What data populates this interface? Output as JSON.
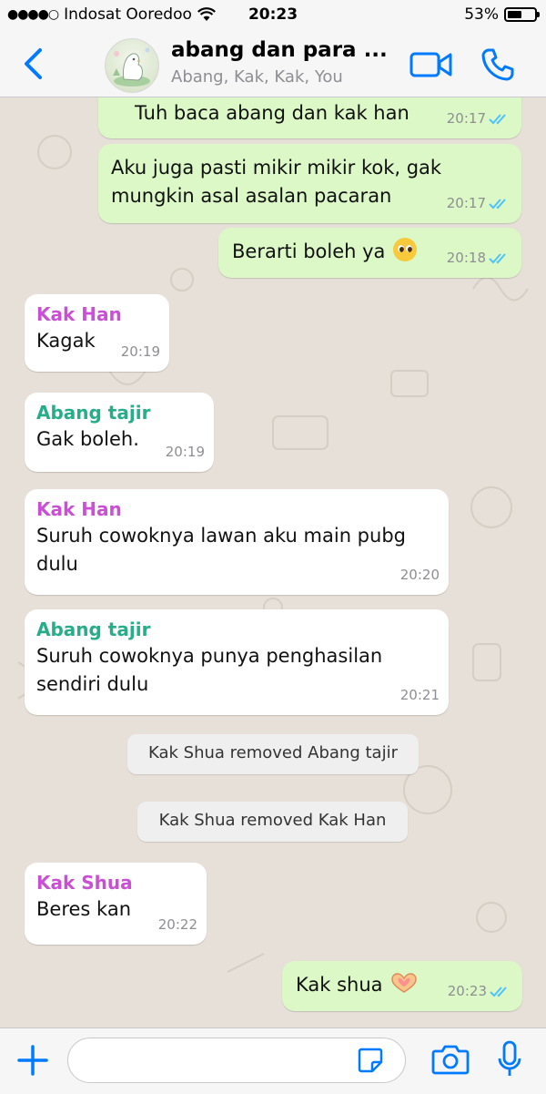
{
  "status_bar": {
    "signal": "●●●●○",
    "carrier": "Indosat Ooredoo",
    "time": "20:23",
    "battery": "53%",
    "battery_level": 0.53
  },
  "header": {
    "title": "abang dan para ...",
    "subtitle": "Abang, Kak, Kak, You"
  },
  "colors": {
    "accent": "#007aff",
    "outgoing_bubble": "#dcf8c6",
    "incoming_bubble": "#ffffff",
    "read_ticks": "#4fc3f7",
    "sender_kak_han": "#c94fd4",
    "sender_abang_tajir": "#27ad8a",
    "sender_kak_shua": "#c94fd4"
  },
  "messages": [
    {
      "text": "Tuh baca abang dan kak han",
      "time": "20:17"
    },
    {
      "text": "Aku juga pasti mikir mikir kok, gak\nmungkin asal asalan pacaran",
      "time": "20:17"
    },
    {
      "text": "Berarti boleh ya",
      "time": "20:18",
      "emoji": "pleading-face"
    },
    {
      "sender": "Kak Han",
      "text": "Kagak",
      "time": "20:19"
    },
    {
      "sender": "Abang tajir",
      "text": "Gak boleh.",
      "time": "20:19"
    },
    {
      "sender": "Kak Han",
      "text": "Suruh cowoknya lawan aku main pubg\ndulu",
      "time": "20:20"
    },
    {
      "sender": "Abang tajir",
      "text": "Suruh cowoknya punya penghasilan\nsendiri dulu",
      "time": "20:21"
    },
    {
      "system": "Kak Shua removed Abang tajir"
    },
    {
      "system": "Kak Shua removed Kak Han"
    },
    {
      "sender": "Kak Shua",
      "text": "Beres kan",
      "time": "20:22"
    },
    {
      "text": "Kak shua",
      "time": "20:23",
      "emoji": "heart-hands"
    }
  ],
  "input": {
    "value": "",
    "placeholder": ""
  }
}
